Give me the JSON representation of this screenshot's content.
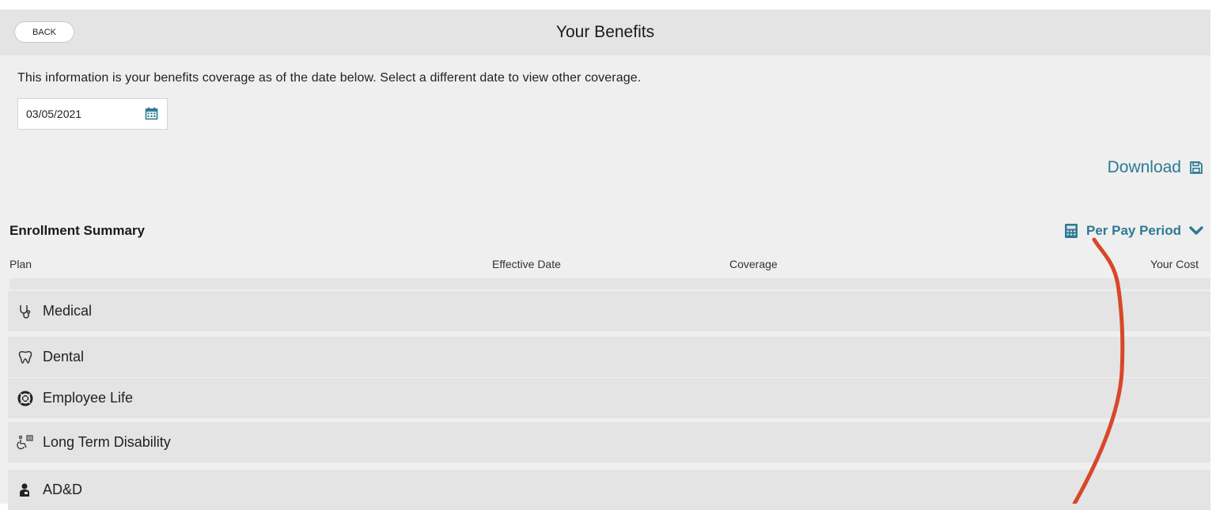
{
  "header": {
    "back_label": "BACK",
    "title": "Your Benefits"
  },
  "info_text": "This information is your benefits coverage as of the date below. Select a different date to view other coverage.",
  "date_field": {
    "value": "03/05/2021",
    "icon": "calendar-icon"
  },
  "download": {
    "label": "Download",
    "icon": "floppy-disk-icon"
  },
  "summary": {
    "title": "Enrollment Summary",
    "period_label": "Per Pay Period",
    "period_icon": "calculator-icon",
    "columns": [
      "Plan",
      "Effective Date",
      "Coverage",
      "Your Cost"
    ]
  },
  "plans": [
    {
      "label": "Medical",
      "icon": "stethoscope-icon"
    },
    {
      "label": "Dental",
      "icon": "tooth-icon"
    },
    {
      "label": "Employee Life",
      "icon": "life-ring-icon"
    },
    {
      "label": "Long Term Disability",
      "icon": "wheelchair-icon"
    },
    {
      "label": "AD&D",
      "icon": "person-badge-icon"
    }
  ],
  "colors": {
    "accent": "#2c7a94",
    "annotation": "#d8472a",
    "header_bg": "#e4e4e4",
    "page_bg": "#efefef"
  }
}
